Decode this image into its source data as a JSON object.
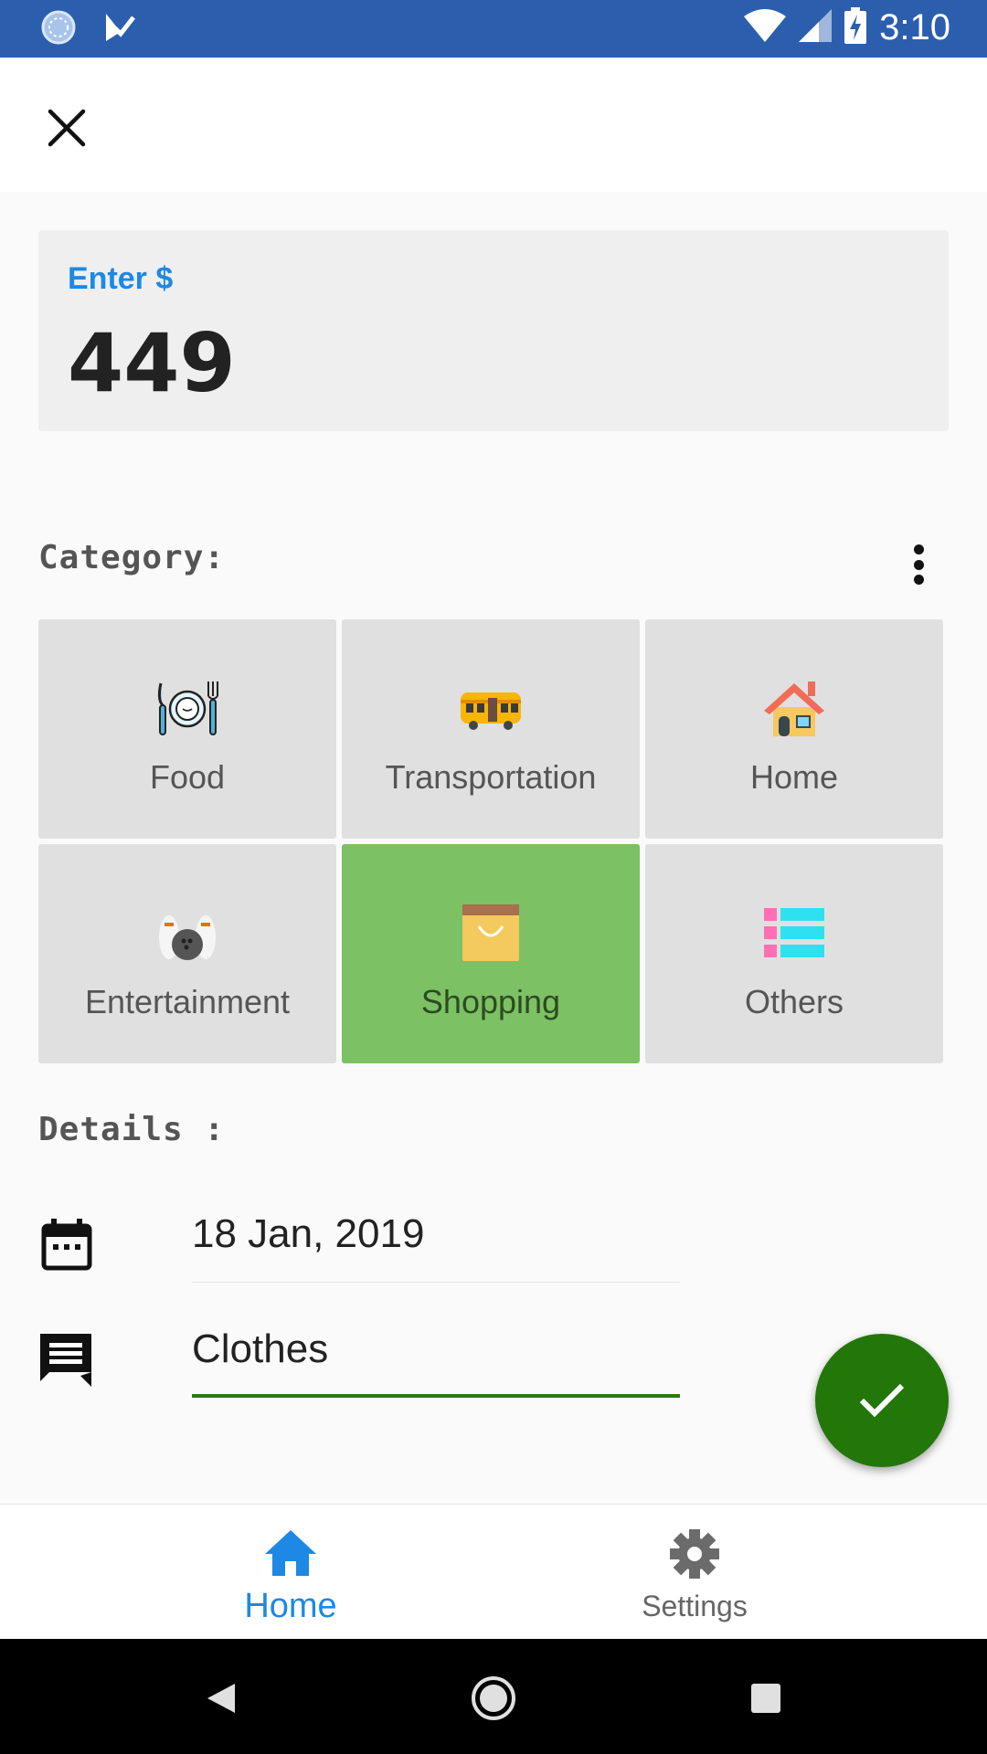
{
  "status_bar": {
    "time": "3:10",
    "icons": [
      "sync-icon",
      "app-notification-icon",
      "wifi-icon",
      "signal-icon",
      "battery-charging-icon"
    ]
  },
  "app_bar": {
    "close_icon": "close-icon"
  },
  "amount": {
    "label": "Enter $",
    "value": "449"
  },
  "category": {
    "label": "Category:",
    "more_icon": "more-vert-icon",
    "items": [
      {
        "label": "Food",
        "icon": "plate-cutlery-icon",
        "selected": false
      },
      {
        "label": "Transportation",
        "icon": "bus-icon",
        "selected": false
      },
      {
        "label": "Home",
        "icon": "house-icon",
        "selected": false
      },
      {
        "label": "Entertainment",
        "icon": "bowling-icon",
        "selected": false
      },
      {
        "label": "Shopping",
        "icon": "shopping-bag-icon",
        "selected": true
      },
      {
        "label": "Others",
        "icon": "list-icon",
        "selected": false
      }
    ],
    "selected_color": "#7cc163",
    "default_color": "#e0e0e0"
  },
  "details": {
    "label": "Details :",
    "date": "18 Jan, 2019",
    "note": "Clothes"
  },
  "fab": {
    "icon": "check-icon",
    "color": "#237608"
  },
  "bottom_nav": {
    "items": [
      {
        "label": "Home",
        "icon": "home-icon",
        "active": true
      },
      {
        "label": "Settings",
        "icon": "gear-icon",
        "active": false
      }
    ],
    "active_color": "#1e88e5"
  },
  "system_nav": {
    "icons": [
      "back-icon",
      "home-circle-icon",
      "recents-icon"
    ]
  },
  "colors": {
    "status_bar": "#2b5fad",
    "accent": "#1e88e5"
  }
}
